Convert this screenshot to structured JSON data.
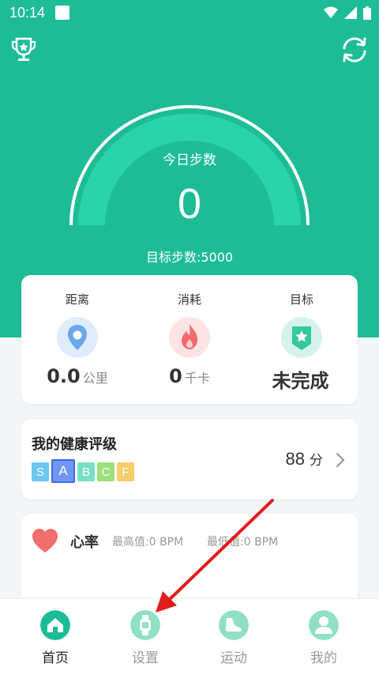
{
  "status_bar": {
    "time": "10:14"
  },
  "main": {
    "gauge_title": "今日步数",
    "steps": "0",
    "target": "目标步数:5000"
  },
  "stats": [
    {
      "label": "距离",
      "value": "0.0",
      "unit": "公里",
      "icon": "location-pin-icon"
    },
    {
      "label": "消耗",
      "value": "0",
      "unit": "千卡",
      "icon": "flame-icon"
    },
    {
      "label": "目标",
      "value": "未完成",
      "unit": "",
      "icon": "star-badge-icon"
    }
  ],
  "health": {
    "title": "我的健康评级",
    "grades": [
      "S",
      "A",
      "B",
      "C",
      "F"
    ],
    "active_grade": "A",
    "score": "88",
    "score_unit": "分"
  },
  "heart": {
    "title": "心率",
    "max": "最高值:0 BPM",
    "min": "最低值:0 BPM"
  },
  "nav": [
    {
      "label": "首页",
      "icon": "home-icon",
      "active": true
    },
    {
      "label": "设置",
      "icon": "watch-icon",
      "active": false
    },
    {
      "label": "运动",
      "icon": "shoe-icon",
      "active": false
    },
    {
      "label": "我的",
      "icon": "user-icon",
      "active": false
    }
  ],
  "colors": {
    "primary": "#1dbc97",
    "arrow": "#e11c1c"
  }
}
